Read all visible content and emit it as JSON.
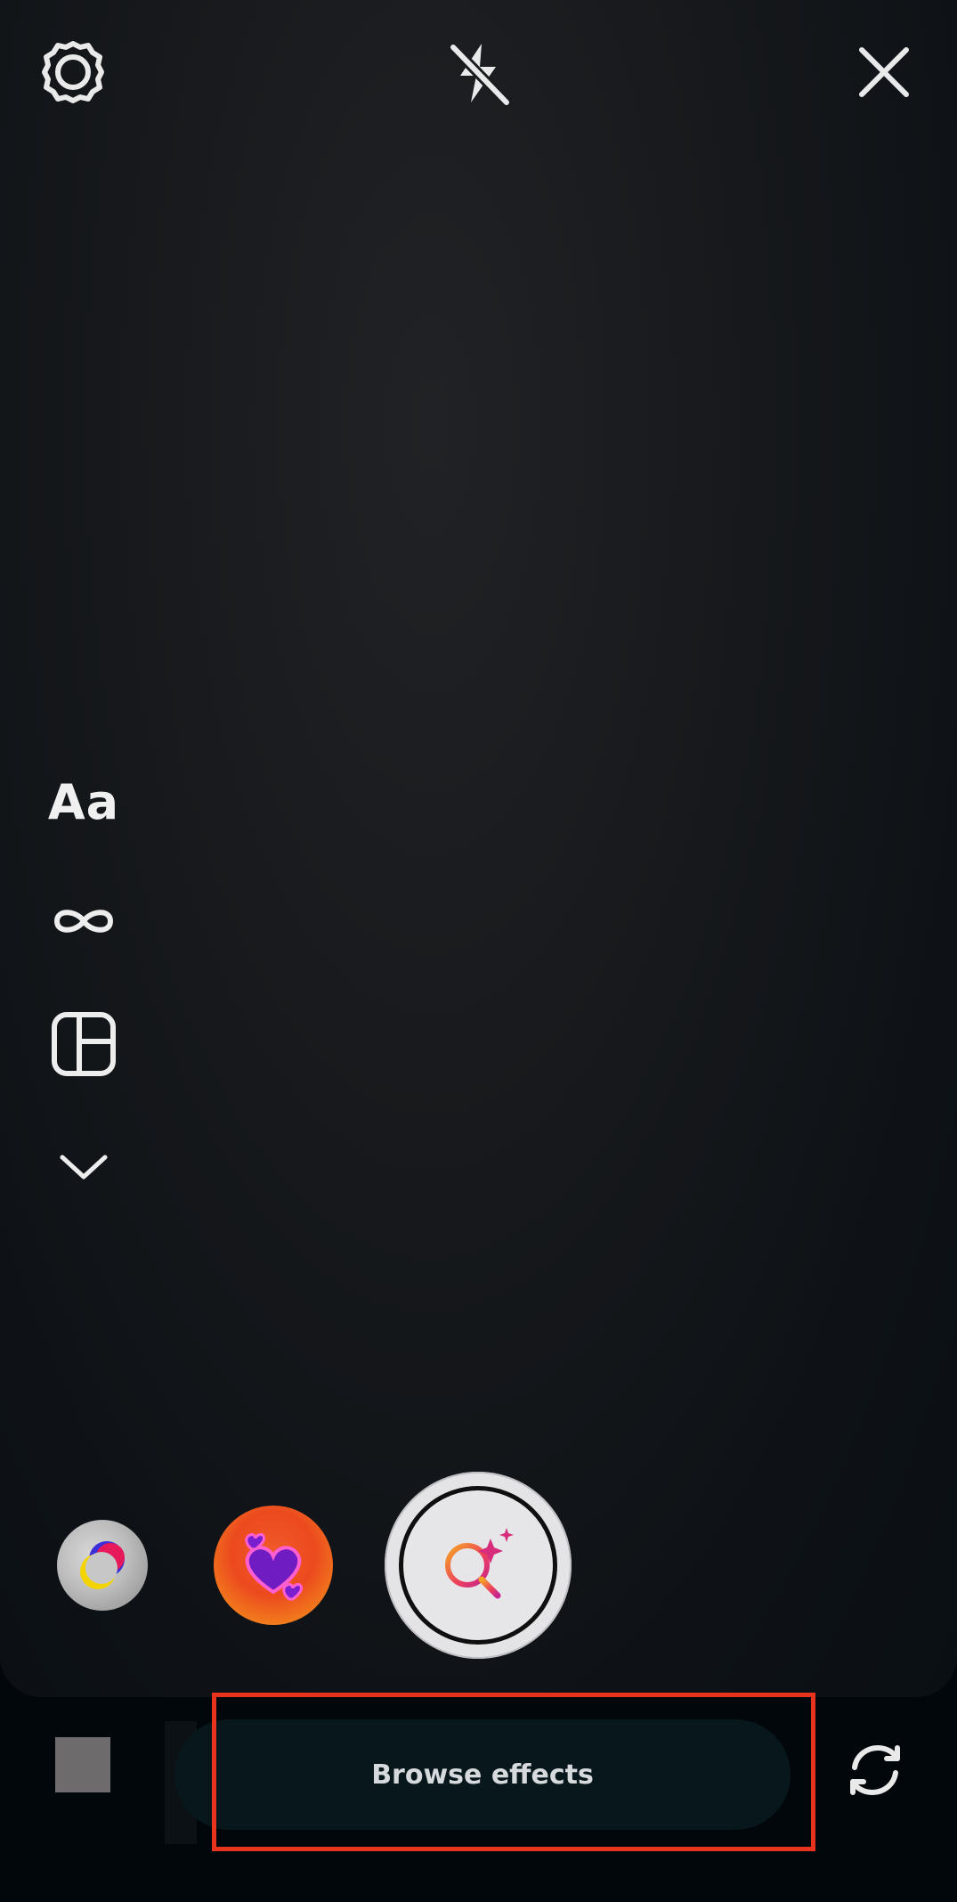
{
  "camera": {
    "top_bar": {
      "settings_icon": "gear-icon",
      "flash_icon": "flash-off-icon",
      "close_icon": "close-icon"
    },
    "side_tools": [
      {
        "name": "text-tool",
        "label": "Aa",
        "icon": "text-icon"
      },
      {
        "name": "boomerang-tool",
        "icon": "infinity-icon"
      },
      {
        "name": "layout-tool",
        "icon": "layout-grid-icon"
      },
      {
        "name": "more-tools",
        "icon": "chevron-down-icon"
      }
    ],
    "effects": [
      {
        "name": "color-effect",
        "icon": "color-orb-icon"
      },
      {
        "name": "hearts-effect",
        "icon": "hearts-icon"
      },
      {
        "name": "browse-effects-capture",
        "icon": "search-sparkle-icon"
      }
    ]
  },
  "bottom_bar": {
    "browse_effects_label": "Browse effects",
    "flip_icon": "flip-camera-icon",
    "gallery_icon": "gallery-thumbnail"
  },
  "colors": {
    "highlight": "#e8341f",
    "accent_gradient_start": "#f05a2a",
    "accent_gradient_end": "#f6a11b"
  }
}
